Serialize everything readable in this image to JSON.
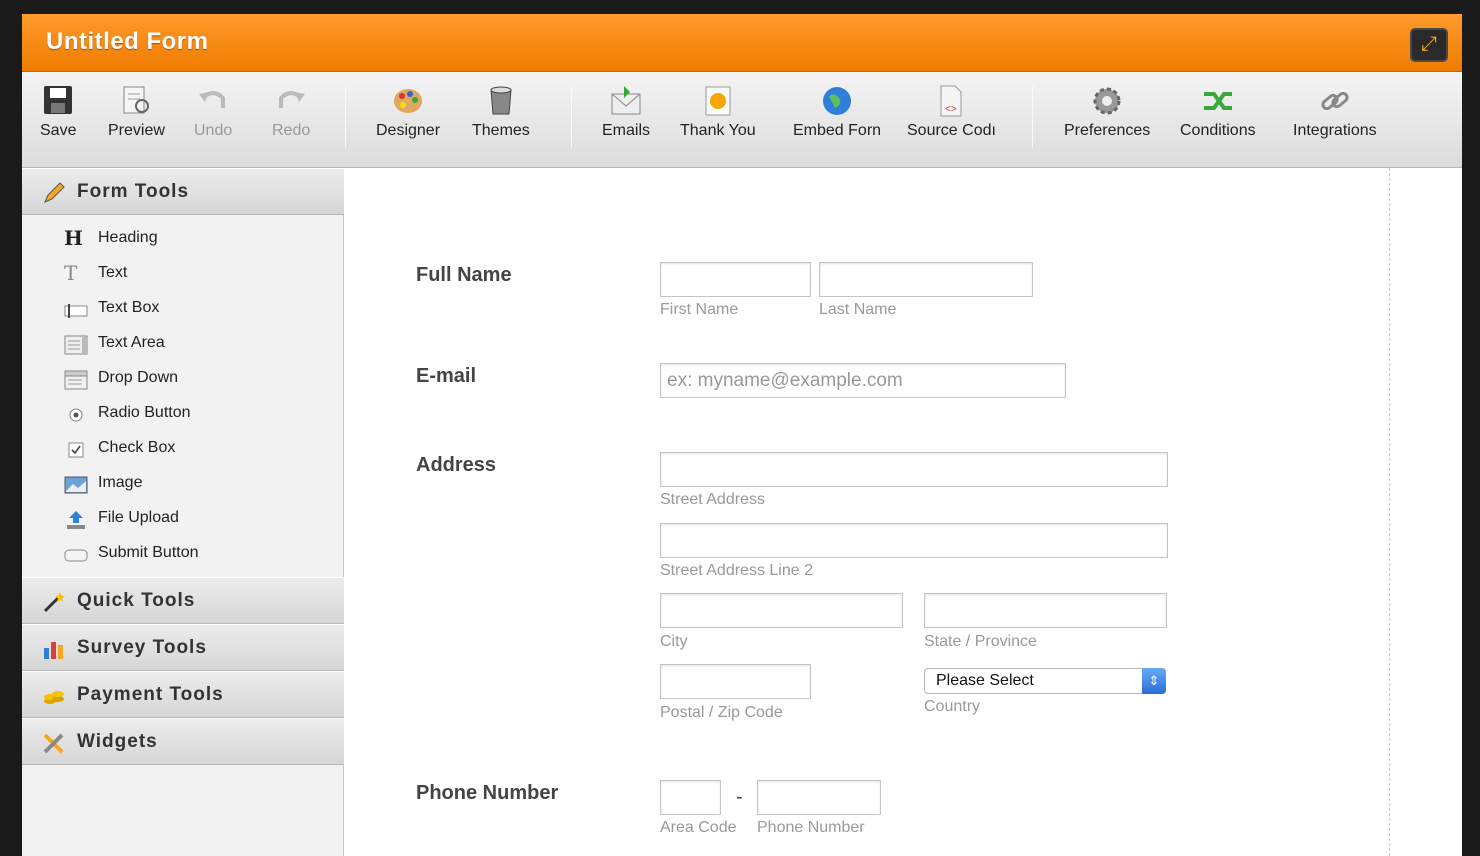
{
  "window": {
    "title": "Untitled Form",
    "fullscreen_icon": "expand-icon"
  },
  "toolbar": {
    "save": "Save",
    "preview": "Preview",
    "undo": "Undo",
    "redo": "Redo",
    "designer": "Designer",
    "themes": "Themes",
    "emails": "Emails",
    "thank_you": "Thank You",
    "embed_form": "Embed Forn",
    "source_code": "Source Codı",
    "preferences": "Preferences",
    "conditions": "Conditions",
    "integrations": "Integrations"
  },
  "sidebar": {
    "form_tools": "Form Tools",
    "items": [
      "Heading",
      "Text",
      "Text Box",
      "Text Area",
      "Drop Down",
      "Radio Button",
      "Check Box",
      "Image",
      "File Upload",
      "Submit Button"
    ],
    "quick_tools": "Quick Tools",
    "survey_tools": "Survey Tools",
    "payment_tools": "Payment Tools",
    "widgets": "Widgets"
  },
  "form": {
    "full_name": {
      "label": "Full Name",
      "first": "First Name",
      "last": "Last Name"
    },
    "email": {
      "label": "E-mail",
      "placeholder": "ex: myname@example.com"
    },
    "address": {
      "label": "Address",
      "street": "Street Address",
      "street2": "Street Address Line 2",
      "city": "City",
      "state": "State / Province",
      "postal": "Postal / Zip Code",
      "country_label": "Country",
      "country_value": "Please Select"
    },
    "phone": {
      "label": "Phone Number",
      "area": "Area Code",
      "number": "Phone Number",
      "dash": "-"
    }
  },
  "colors": {
    "titlebar": "#f07c00",
    "accent_blue": "#2a6ed8"
  }
}
